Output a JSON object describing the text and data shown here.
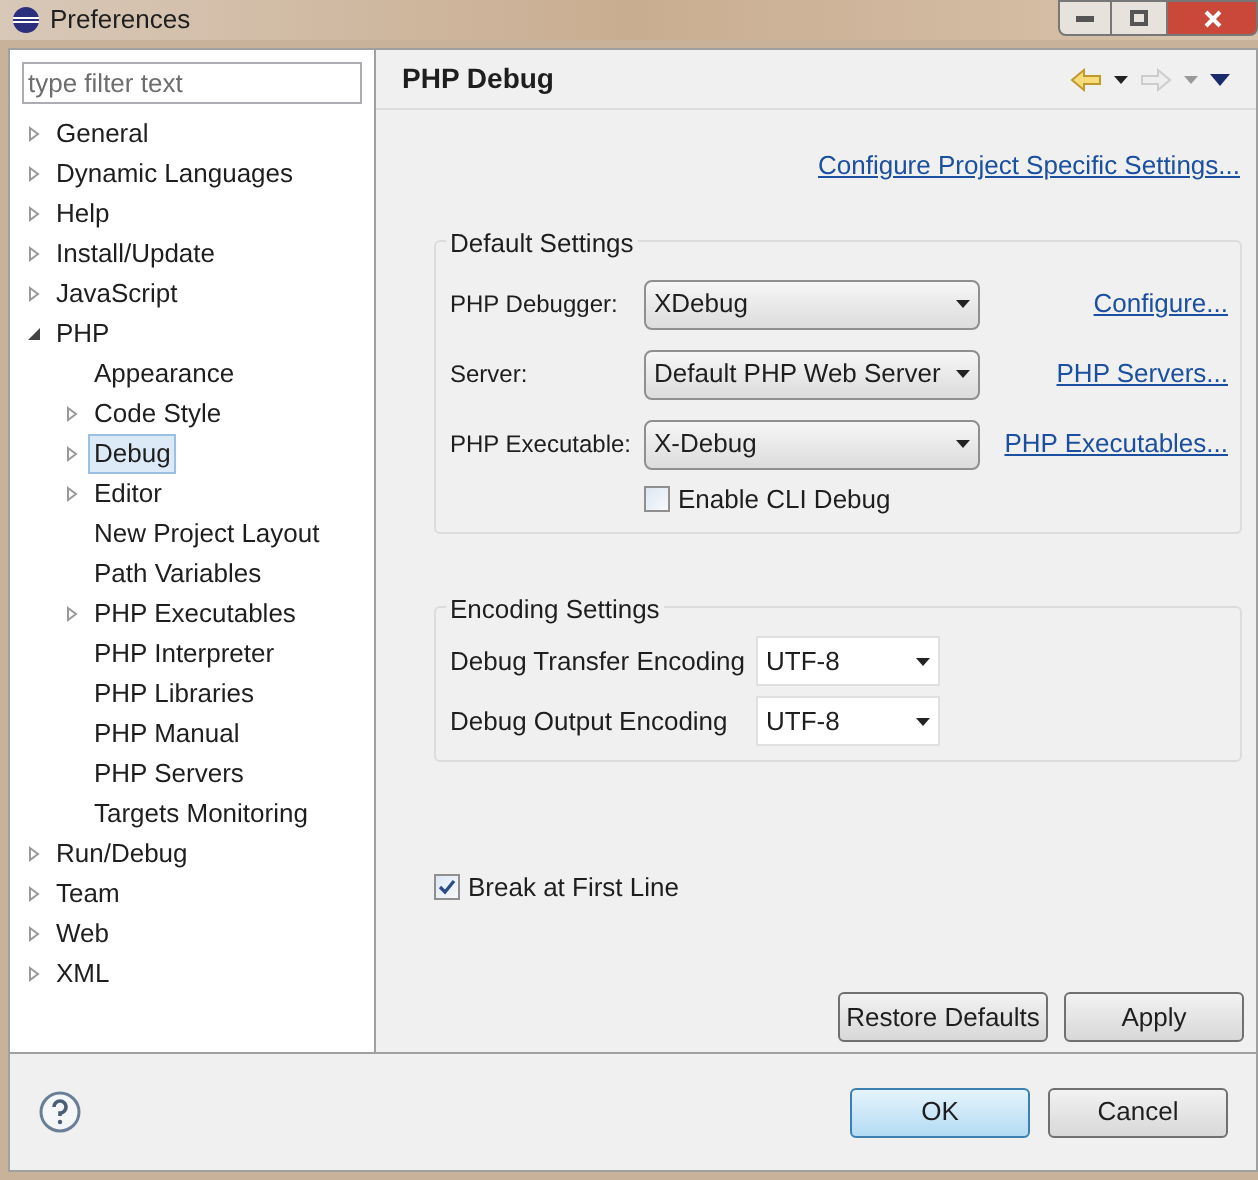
{
  "window": {
    "title": "Preferences"
  },
  "filter": {
    "placeholder": "type filter text"
  },
  "tree": [
    {
      "label": "General",
      "expanded": false,
      "selected": false
    },
    {
      "label": "Dynamic Languages",
      "expanded": false,
      "selected": false
    },
    {
      "label": "Help",
      "expanded": false,
      "selected": false
    },
    {
      "label": "Install/Update",
      "expanded": false,
      "selected": false
    },
    {
      "label": "JavaScript",
      "expanded": false,
      "selected": false
    },
    {
      "label": "PHP",
      "expanded": true,
      "selected": false,
      "children": [
        {
          "label": "Appearance",
          "selected": false
        },
        {
          "label": "Code Style",
          "expanded": false,
          "selected": false
        },
        {
          "label": "Debug",
          "expanded": false,
          "selected": true
        },
        {
          "label": "Editor",
          "expanded": false,
          "selected": false
        },
        {
          "label": "New Project Layout",
          "selected": false
        },
        {
          "label": "Path Variables",
          "selected": false
        },
        {
          "label": "PHP Executables",
          "expanded": false,
          "selected": false
        },
        {
          "label": "PHP Interpreter",
          "selected": false
        },
        {
          "label": "PHP Libraries",
          "selected": false
        },
        {
          "label": "PHP Manual",
          "selected": false
        },
        {
          "label": "PHP Servers",
          "selected": false
        },
        {
          "label": "Targets Monitoring",
          "selected": false
        }
      ]
    },
    {
      "label": "Run/Debug",
      "expanded": false,
      "selected": false
    },
    {
      "label": "Team",
      "expanded": false,
      "selected": false
    },
    {
      "label": "Web",
      "expanded": false,
      "selected": false
    },
    {
      "label": "XML",
      "expanded": false,
      "selected": false
    }
  ],
  "page": {
    "title": "PHP Debug",
    "project_link": "Configure Project Specific Settings...",
    "default_settings": {
      "legend": "Default Settings",
      "rows": [
        {
          "label": "PHP Debugger:",
          "value": "XDebug",
          "link": "Configure..."
        },
        {
          "label": "Server:",
          "value": "Default PHP Web Server",
          "link": "PHP Servers..."
        },
        {
          "label": "PHP Executable:",
          "value": "X-Debug",
          "link": "PHP Executables..."
        }
      ],
      "cli": {
        "label": "Enable CLI Debug",
        "checked": false
      }
    },
    "encoding_settings": {
      "legend": "Encoding Settings",
      "rows": [
        {
          "label": "Debug Transfer Encoding",
          "value": "UTF-8"
        },
        {
          "label": "Debug Output Encoding",
          "value": "UTF-8"
        }
      ]
    },
    "break_first_line": {
      "label": "Break at First Line",
      "checked": true
    },
    "buttons": [
      "Restore Defaults",
      "Apply"
    ]
  },
  "footer": {
    "buttons": [
      {
        "label": "OK",
        "default": true
      },
      {
        "label": "Cancel",
        "default": false
      }
    ]
  }
}
